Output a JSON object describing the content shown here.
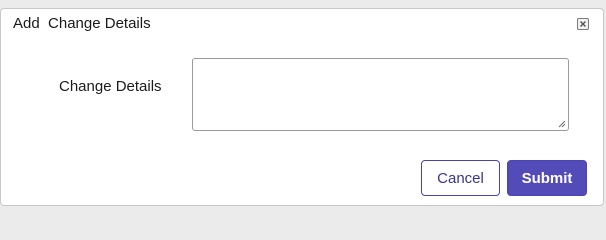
{
  "dialog": {
    "title": "Add  Change Details",
    "close_icon": "close-icon"
  },
  "form": {
    "field_label": "Change Details",
    "field_value": "",
    "resize_icon": "resize-grip-icon"
  },
  "actions": {
    "cancel_label": "Cancel",
    "submit_label": "Submit"
  },
  "colors": {
    "accent": "#534bb8",
    "cancel_text": "#3a3495"
  }
}
